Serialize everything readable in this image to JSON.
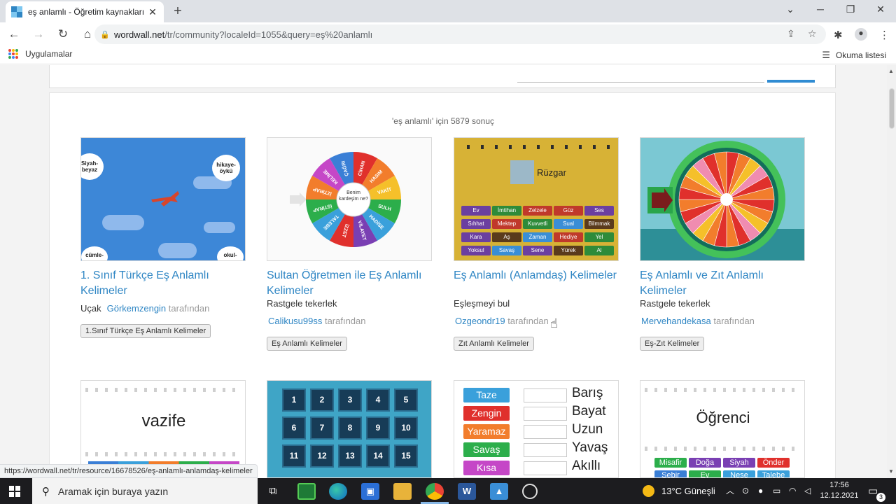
{
  "browser": {
    "tab_title": "eş anlamlı - Öğretim kaynakları",
    "new_tab": "+",
    "tab_close": "✕",
    "url_host": "wordwall.net",
    "url_path": "/tr/community?localeId=1055&query=eş%20anlamlı",
    "bookmarks_apps": "Uygulamalar",
    "reading_list": "Okuma listesi",
    "status_url": "https://wordwall.net/tr/resource/16678526/eş-anlamlı-anlamdaş-kelimeler"
  },
  "results": {
    "count_text": "'eş anlamlı' için 5879 sonuç",
    "author_suffix": "tarafından",
    "cards": [
      {
        "title": "1. Sınıf Türkçe Eş Anlamlı Kelimeler",
        "type": "Uçak",
        "author": "Görkemzengin",
        "tag": "1.Sınıf Türkçe Eş Anlamlı Kelimeler",
        "thumb": {
          "clouds": [
            "Siyah-beyaz",
            "hikaye-öykü",
            "cümle-",
            "okul-"
          ]
        }
      },
      {
        "title": "Sultan Öğretmen ile Eş Anlamlı Kelimeler",
        "type": "Rastgele tekerlek",
        "author": "Calikusu99ss",
        "tag": "Eş Anlamlı Kelimeler",
        "thumb": {
          "center": "Benim kardeşim ne?",
          "words": [
            "CİHAN",
            "HASIM",
            "VAKİT",
            "SULH",
            "HADİSE",
            "VİLAYET",
            "İZZET",
            "TALEBE",
            "İSTİRAP",
            "İZTİRAP",
            "KELİME",
            "ÇAĞRI"
          ]
        }
      },
      {
        "title": "Eş Anlamlı (Anlamdaş) Kelimeler",
        "type": "Eşleşmeyi bul",
        "author": "Ozgeondr19",
        "tag": "Zıt Anlamlı Kelimeler",
        "thumb": {
          "word": "Rüzgar",
          "tiles": [
            [
              "Ev",
              "#6b3fa0"
            ],
            [
              "İmtihan",
              "#2e8b3a"
            ],
            [
              "Zelzele",
              "#c0392b"
            ],
            [
              "Güz",
              "#c0392b"
            ],
            [
              "Ses",
              "#6b3fa0"
            ],
            [
              "Sıhhat",
              "#6b3fa0"
            ],
            [
              "Mektep",
              "#c0392b"
            ],
            [
              "Kuvvetli",
              "#2e8b3a"
            ],
            [
              "Sual",
              "#3a8ed6"
            ],
            [
              "Bilmmak",
              "#5a3b1c"
            ],
            [
              "Kara",
              "#6b3fa0"
            ],
            [
              "Aş",
              "#5a3b1c"
            ],
            [
              "Zaman",
              "#3a8ed6"
            ],
            [
              "Hediye",
              "#c0392b"
            ],
            [
              "Yel",
              "#2e8b3a"
            ],
            [
              "Yoksul",
              "#6b3fa0"
            ],
            [
              "Savaş",
              "#3a8ed6"
            ],
            [
              "Sene",
              "#6b3fa0"
            ],
            [
              "Yürek",
              "#5a3b1c"
            ],
            [
              "Al",
              "#2e8b3a"
            ]
          ]
        }
      },
      {
        "title": "Eş Anlamlı ve Zıt Anlamlı Kelimeler",
        "type": "Rastgele tekerlek",
        "author": "Mervehandekasa",
        "tag": "Eş-Zıt Kelimeler",
        "thumb": {}
      },
      {
        "thumb": {
          "word": "vazife"
        }
      },
      {
        "thumb": {
          "numbers": [
            "1",
            "2",
            "3",
            "4",
            "5",
            "6",
            "7",
            "8",
            "9",
            "10",
            "11",
            "12",
            "13",
            "14",
            "15"
          ]
        }
      },
      {
        "thumb": {
          "buttons": [
            [
              "Taze",
              "#3aa0db"
            ],
            [
              "Zengin",
              "#e0302c"
            ],
            [
              "Yaramaz",
              "#f27d2c"
            ],
            [
              "Savaş",
              "#2cae4b"
            ],
            [
              "Kısa",
              "#c547c7"
            ]
          ],
          "words": [
            "Barış",
            "Bayat",
            "Uzun",
            "Yavaş",
            "Akıllı"
          ]
        }
      },
      {
        "thumb": {
          "word": "Öğrenci",
          "chips": [
            [
              "Misafir",
              "#2cae4b"
            ],
            [
              "Doğa",
              "#7a3fb3"
            ],
            [
              "Siyah",
              "#7a3fb3"
            ],
            [
              "Önder",
              "#e0302c"
            ],
            [
              "Sebir",
              "#3a7fd6"
            ],
            [
              "Ev",
              "#2cae4b"
            ],
            [
              "Neşe",
              "#3aa0db"
            ],
            [
              "Talebe",
              "#3aa0db"
            ]
          ]
        }
      }
    ]
  },
  "taskbar": {
    "search_placeholder": "Aramak için buraya yazın",
    "weather": "13°C  Güneşli",
    "time": "17:56",
    "date": "12.12.2021",
    "notif_count": "3"
  },
  "colors": {
    "link": "#2f86c4",
    "accent": "#2f8bd2"
  }
}
